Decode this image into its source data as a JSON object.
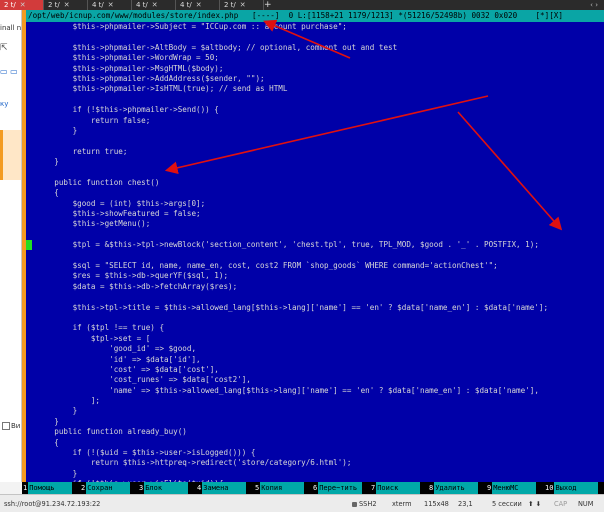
{
  "tabs": [
    {
      "label": "2 t/",
      "active": true
    },
    {
      "label": "2 t/",
      "active": false
    },
    {
      "label": "4 t/",
      "active": false
    },
    {
      "label": "4 t/",
      "active": false
    },
    {
      "label": "4 t/",
      "active": false
    },
    {
      "label": "2 t/",
      "active": false
    }
  ],
  "left_pane": {
    "line1": "inall ne",
    "line2": "ку",
    "checkbox_label": "Ви"
  },
  "statusline": "/opt/web/icnup.com/www/modules/store/index.php   [----]  0 L:[1158+21 1179/1213] *(51216/52498b) 0032 0x020    [*][X]",
  "code_lines": [
    "        $this->phpmailer->Subject = \"ICCup.com :: account purchase\";",
    "",
    "        $this->phpmailer->AltBody = $altbody; // optional, comment out and test",
    "        $this->phpmailer->WordWrap = 50;",
    "        $this->phpmailer->MsgHTML($body);",
    "        $this->phpmailer->AddAddress($sender, \"\");",
    "        $this->phpmailer->IsHTML(true); // send as HTML",
    "",
    "        if (!$this->phpmailer->Send()) {",
    "            return false;",
    "        }",
    "",
    "        return true;",
    "    }",
    "",
    "    public function chest()",
    "    {",
    "        $good = (int) $this->args[0];",
    "        $this->showFeatured = false;",
    "        $this->getMenu();",
    "",
    "        $tpl = &$this->tpl->newBlock('section_content', 'chest.tpl', true, TPL_MOD, $good . '_' . POSTFIX, 1);",
    "",
    "        $sql = \"SELECT id, name, name_en, cost, cost2 FROM `shop_goods` WHERE command='actionChest'\";",
    "        $res = $this->db->querYF($sql, 1);",
    "        $data = $this->db->fetchArray($res);",
    "",
    "        $this->tpl->title = $this->allowed_lang[$this->lang]['name'] == 'en' ? $data['name_en'] : $data['name'];",
    "",
    "        if ($tpl !== true) {",
    "            $tpl->set = [",
    "                'good_id' => $good,",
    "                'id' => $data['id'],",
    "                'cost' => $data['cost'],",
    "                'cost_runes' => $data['cost2'],",
    "                'name' => $this->allowed_lang[$this->lang]['name'] == 'en' ? $data['name_en'] : $data['name'],",
    "            ];",
    "        }",
    "    }",
    "    public function already_buy()",
    "    {",
    "        if (!($uid = $this->user->isLogged())) {",
    "            return $this->httpreq->redirect('store/category/6.html');",
    "        }",
    "        if (!$this->user->isElite($uid)){",
    "            return $this->httpreq->redirect('store/category/6.html');"
  ],
  "fkeys": [
    {
      "num": "1",
      "label": "Помощь"
    },
    {
      "num": "2",
      "label": "Сохран"
    },
    {
      "num": "3",
      "label": "Блок"
    },
    {
      "num": "4",
      "label": "Замена"
    },
    {
      "num": "5",
      "label": "Копия"
    },
    {
      "num": "6",
      "label": "Пере~тить"
    },
    {
      "num": "7",
      "label": "Поиск"
    },
    {
      "num": "8",
      "label": "Удалить"
    },
    {
      "num": "9",
      "label": "МенюМС"
    },
    {
      "num": "10",
      "label": "Выход"
    }
  ],
  "winstatus": {
    "session": "ssh://root@91.234.72.193:22",
    "protocol": "SSH2",
    "term": "xterm",
    "size": "115x48",
    "pos": "23,1",
    "sessions": "5 сессии",
    "caps": "CAP",
    "num": "NUM"
  },
  "colors": {
    "terminal_bg": "#0000a8",
    "statusline_bg": "#0aa5a5",
    "keyword": "#ffff55",
    "string": "#55ffff",
    "annotation_arrow": "#e01010"
  }
}
